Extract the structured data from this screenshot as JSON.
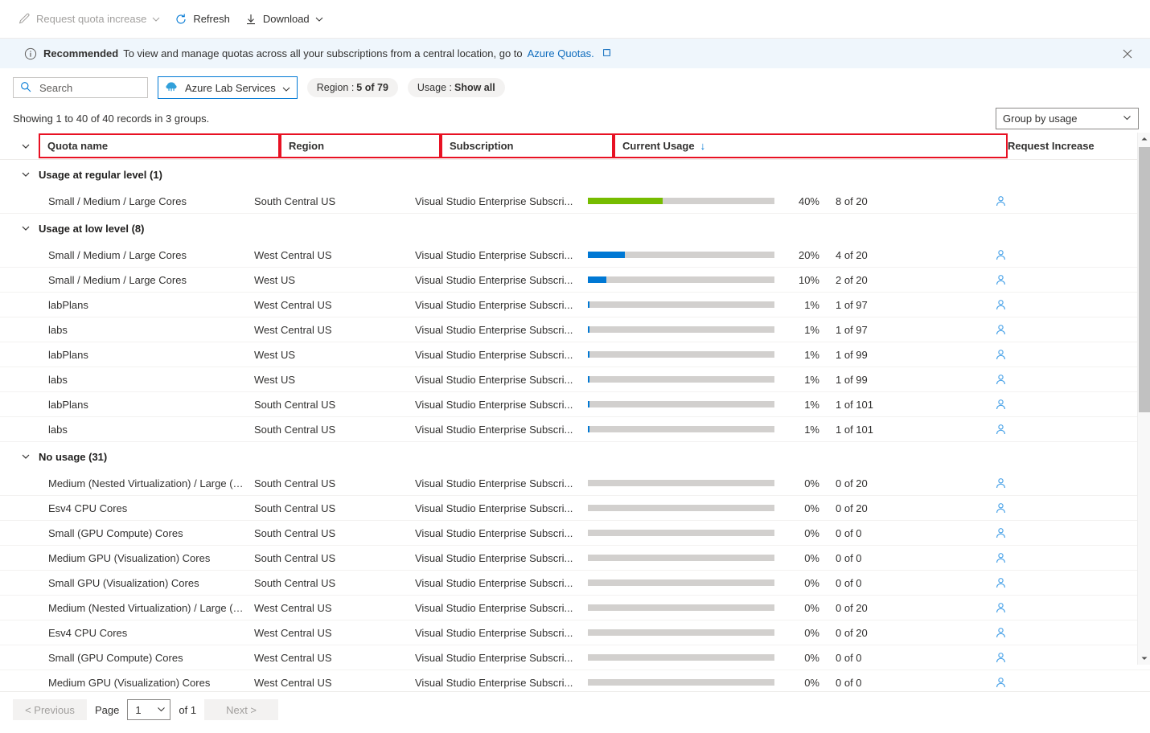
{
  "toolbar": {
    "request_quota_increase": "Request quota increase",
    "refresh": "Refresh",
    "download": "Download"
  },
  "banner": {
    "label": "Recommended",
    "message": "To view and manage quotas across all your subscriptions from a central location, go to",
    "link_text": "Azure Quotas.",
    "close_label": "×"
  },
  "filters": {
    "search_placeholder": "Search",
    "search_value": "",
    "provider": "Azure Lab Services",
    "region_pill_prefix": "Region :",
    "region_pill_value": "5 of 79",
    "usage_pill_prefix": "Usage :",
    "usage_pill_value": "Show all"
  },
  "summary": {
    "showing_text": "Showing 1 to 40 of 40 records in 3 groups.",
    "group_by": "Group by usage"
  },
  "columns": {
    "quota_name": "Quota name",
    "region": "Region",
    "subscription": "Subscription",
    "current_usage": "Current Usage",
    "sort_indicator": "↓",
    "request_increase": "Request Increase"
  },
  "groups": [
    {
      "title": "Usage at regular level (1)",
      "rows": [
        {
          "quota": "Small / Medium / Large Cores",
          "region": "South Central US",
          "subscription": "Visual Studio Enterprise Subscri...",
          "percent": 40,
          "percent_label": "40%",
          "count_label": "8 of 20",
          "bar_color": "green"
        }
      ]
    },
    {
      "title": "Usage at low level (8)",
      "rows": [
        {
          "quota": "Small / Medium / Large Cores",
          "region": "West Central US",
          "subscription": "Visual Studio Enterprise Subscri...",
          "percent": 20,
          "percent_label": "20%",
          "count_label": "4 of 20",
          "bar_color": "blue"
        },
        {
          "quota": "Small / Medium / Large Cores",
          "region": "West US",
          "subscription": "Visual Studio Enterprise Subscri...",
          "percent": 10,
          "percent_label": "10%",
          "count_label": "2 of 20",
          "bar_color": "blue"
        },
        {
          "quota": "labPlans",
          "region": "West Central US",
          "subscription": "Visual Studio Enterprise Subscri...",
          "percent": 1,
          "percent_label": "1%",
          "count_label": "1 of 97",
          "bar_color": "blue"
        },
        {
          "quota": "labs",
          "region": "West Central US",
          "subscription": "Visual Studio Enterprise Subscri...",
          "percent": 1,
          "percent_label": "1%",
          "count_label": "1 of 97",
          "bar_color": "blue"
        },
        {
          "quota": "labPlans",
          "region": "West US",
          "subscription": "Visual Studio Enterprise Subscri...",
          "percent": 1,
          "percent_label": "1%",
          "count_label": "1 of 99",
          "bar_color": "blue"
        },
        {
          "quota": "labs",
          "region": "West US",
          "subscription": "Visual Studio Enterprise Subscri...",
          "percent": 1,
          "percent_label": "1%",
          "count_label": "1 of 99",
          "bar_color": "blue"
        },
        {
          "quota": "labPlans",
          "region": "South Central US",
          "subscription": "Visual Studio Enterprise Subscri...",
          "percent": 1,
          "percent_label": "1%",
          "count_label": "1 of 101",
          "bar_color": "blue"
        },
        {
          "quota": "labs",
          "region": "South Central US",
          "subscription": "Visual Studio Enterprise Subscri...",
          "percent": 1,
          "percent_label": "1%",
          "count_label": "1 of 101",
          "bar_color": "blue"
        }
      ]
    },
    {
      "title": "No usage (31)",
      "rows": [
        {
          "quota": "Medium (Nested Virtualization) / Large (Nested ...",
          "region": "South Central US",
          "subscription": "Visual Studio Enterprise Subscri...",
          "percent": 0,
          "percent_label": "0%",
          "count_label": "0 of 20",
          "bar_color": "none"
        },
        {
          "quota": "Esv4 CPU Cores",
          "region": "South Central US",
          "subscription": "Visual Studio Enterprise Subscri...",
          "percent": 0,
          "percent_label": "0%",
          "count_label": "0 of 20",
          "bar_color": "none"
        },
        {
          "quota": "Small (GPU Compute) Cores",
          "region": "South Central US",
          "subscription": "Visual Studio Enterprise Subscri...",
          "percent": 0,
          "percent_label": "0%",
          "count_label": "0 of 0",
          "bar_color": "none"
        },
        {
          "quota": "Medium GPU (Visualization) Cores",
          "region": "South Central US",
          "subscription": "Visual Studio Enterprise Subscri...",
          "percent": 0,
          "percent_label": "0%",
          "count_label": "0 of 0",
          "bar_color": "none"
        },
        {
          "quota": "Small GPU (Visualization) Cores",
          "region": "South Central US",
          "subscription": "Visual Studio Enterprise Subscri...",
          "percent": 0,
          "percent_label": "0%",
          "count_label": "0 of 0",
          "bar_color": "none"
        },
        {
          "quota": "Medium (Nested Virtualization) / Large (Nested ...",
          "region": "West Central US",
          "subscription": "Visual Studio Enterprise Subscri...",
          "percent": 0,
          "percent_label": "0%",
          "count_label": "0 of 20",
          "bar_color": "none"
        },
        {
          "quota": "Esv4 CPU Cores",
          "region": "West Central US",
          "subscription": "Visual Studio Enterprise Subscri...",
          "percent": 0,
          "percent_label": "0%",
          "count_label": "0 of 20",
          "bar_color": "none"
        },
        {
          "quota": "Small (GPU Compute) Cores",
          "region": "West Central US",
          "subscription": "Visual Studio Enterprise Subscri...",
          "percent": 0,
          "percent_label": "0%",
          "count_label": "0 of 0",
          "bar_color": "none"
        },
        {
          "quota": "Medium GPU (Visualization) Cores",
          "region": "West Central US",
          "subscription": "Visual Studio Enterprise Subscri...",
          "percent": 0,
          "percent_label": "0%",
          "count_label": "0 of 0",
          "bar_color": "none"
        }
      ]
    }
  ],
  "pagination": {
    "previous": "< Previous",
    "page_label": "Page",
    "page_value": "1",
    "of_label": "of 1",
    "next": "Next >"
  },
  "colors": {
    "accent": "#0078d4",
    "green": "#76bc00",
    "track": "#d2d0ce",
    "annotation": "#e81123"
  }
}
